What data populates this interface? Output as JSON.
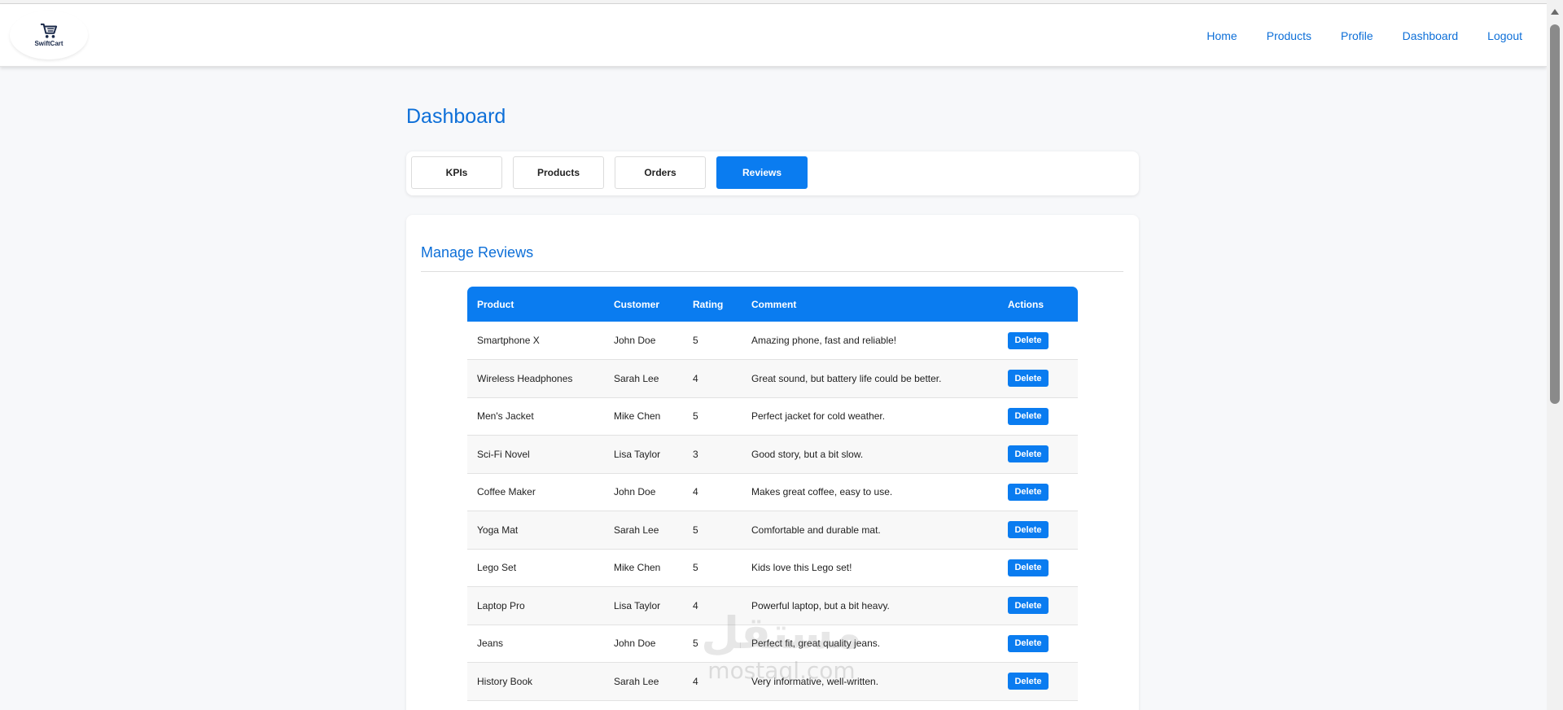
{
  "brand": {
    "name": "SwiftCart"
  },
  "nav": {
    "items": [
      {
        "label": "Home"
      },
      {
        "label": "Products"
      },
      {
        "label": "Profile"
      },
      {
        "label": "Dashboard"
      },
      {
        "label": "Logout"
      }
    ]
  },
  "page": {
    "title": "Dashboard"
  },
  "tabs": [
    {
      "label": "KPIs",
      "active": false
    },
    {
      "label": "Products",
      "active": false
    },
    {
      "label": "Orders",
      "active": false
    },
    {
      "label": "Reviews",
      "active": true
    }
  ],
  "reviews": {
    "title": "Manage Reviews",
    "columns": [
      "Product",
      "Customer",
      "Rating",
      "Comment",
      "Actions"
    ],
    "delete_label": "Delete",
    "rows": [
      {
        "product": "Smartphone X",
        "customer": "John Doe",
        "rating": "5",
        "comment": "Amazing phone, fast and reliable!"
      },
      {
        "product": "Wireless Headphones",
        "customer": "Sarah Lee",
        "rating": "4",
        "comment": "Great sound, but battery life could be better."
      },
      {
        "product": "Men's Jacket",
        "customer": "Mike Chen",
        "rating": "5",
        "comment": "Perfect jacket for cold weather."
      },
      {
        "product": "Sci-Fi Novel",
        "customer": "Lisa Taylor",
        "rating": "3",
        "comment": "Good story, but a bit slow."
      },
      {
        "product": "Coffee Maker",
        "customer": "John Doe",
        "rating": "4",
        "comment": "Makes great coffee, easy to use."
      },
      {
        "product": "Yoga Mat",
        "customer": "Sarah Lee",
        "rating": "5",
        "comment": "Comfortable and durable mat."
      },
      {
        "product": "Lego Set",
        "customer": "Mike Chen",
        "rating": "5",
        "comment": "Kids love this Lego set!"
      },
      {
        "product": "Laptop Pro",
        "customer": "Lisa Taylor",
        "rating": "4",
        "comment": "Powerful laptop, but a bit heavy."
      },
      {
        "product": "Jeans",
        "customer": "John Doe",
        "rating": "5",
        "comment": "Perfect fit, great quality jeans."
      },
      {
        "product": "History Book",
        "customer": "Sarah Lee",
        "rating": "4",
        "comment": "Very informative, well-written."
      }
    ]
  },
  "watermark": {
    "logo": "مستقل",
    "text": "mostaql.com"
  },
  "colors": {
    "accent": "#0a7cf0",
    "link": "#0d6fd8",
    "background": "#f7f8fa"
  },
  "icons": {
    "brand": "shopping-cart-icon",
    "scroll_up": "arrow-up-icon"
  }
}
